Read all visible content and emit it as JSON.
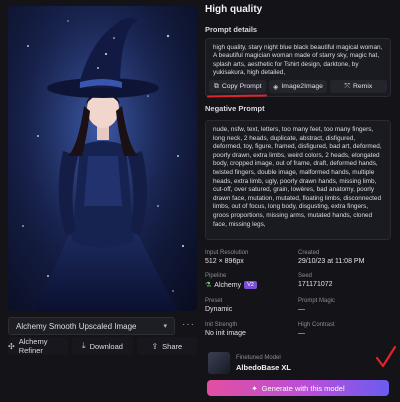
{
  "left": {
    "model_select": {
      "value": "Alchemy Smooth Upscaled Image",
      "caret": "▾"
    },
    "more_label": "···",
    "actions": [
      {
        "label": "Alchemy Refiner",
        "icon": "sparkle-icon",
        "glyph": "✣"
      },
      {
        "label": "Download",
        "icon": "download-icon",
        "glyph": "⤓"
      },
      {
        "label": "Share",
        "icon": "share-icon",
        "glyph": "⇪"
      }
    ]
  },
  "right": {
    "title": "High quality",
    "prompt_details_label": "Prompt details",
    "prompt_text": "high quality, stary night blue black beautiful magical woman, A beautiful magician woman made of starry sky, magic hat, splash arts, aesthetic for Tshirt design, darktone, by yukisakura, high detailed,",
    "prompt_actions": [
      {
        "label": "Copy Prompt",
        "icon": "copy-icon",
        "glyph": "⧉"
      },
      {
        "label": "Image2Image",
        "icon": "layers-icon",
        "glyph": "◈"
      },
      {
        "label": "Remix",
        "icon": "remix-icon",
        "glyph": "⤧"
      }
    ],
    "negative_label": "Negative Prompt",
    "negative_text": "nude, nsfw, text, letters, too many feet, too many fingers, long neck, 2 heads, duplicate, abstract, disfigured, deformed, toy, figure, framed, disfigured, bad art, deformed, poorly drawn, extra limbs, weird colors, 2 heads, elongated body, cropped image, out of frame, draft, deformed hands, twisted fingers, double image, malformed hands, multiple heads, extra limb, ugly, poorly drawn hands, missing limb, cut-off, over satured, grain, lowères, bad anatomy, poorly drawn face, mutation, mutated, floating limbs, disconnected limbs, out of focus, long body, disgusting, extra fingers, groos proportions, missing arms, mutated hands, cloned face, missing legs,",
    "meta": [
      [
        {
          "label": "Input Resolution",
          "value": "512 × 896px"
        },
        {
          "label": "Created",
          "value": "29/10/23 at 11:08 PM"
        }
      ],
      [
        {
          "label": "Pipeline",
          "value": "Alchemy",
          "badge": "V2"
        },
        {
          "label": "Seed",
          "value": "171171072"
        }
      ],
      [
        {
          "label": "Preset",
          "value": "Dynamic"
        },
        {
          "label": "Prompt Magic",
          "value": "—"
        }
      ],
      [
        {
          "label": "Init Strength",
          "value": "No init image"
        },
        {
          "label": "High Contrast",
          "value": "—"
        }
      ]
    ],
    "finetuned": {
      "label": "Finetuned Model",
      "name": "AlbedoBase XL"
    },
    "generate_label": "Generate with this model",
    "generate_glyph": "✦"
  }
}
